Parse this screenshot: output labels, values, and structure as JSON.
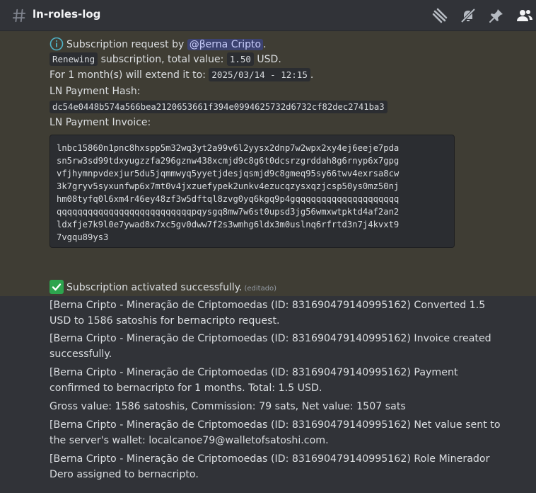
{
  "channel": {
    "name": "ln-roles-log"
  },
  "header_icons": [
    "threads-icon",
    "mute-bell-icon",
    "pin-icon",
    "members-icon"
  ],
  "embed": {
    "request_text": "Subscription request by",
    "mention": "@βerna Cripto",
    "period_end": ".",
    "renewing_code": "Renewing",
    "renewing_rest": "subscription, total value:",
    "value_code": "1.50",
    "currency": "USD.",
    "extend_text": "For 1 month(s) will extend it to:",
    "extend_date": "2025/03/14 - 12:15",
    "hash_label": "LN Payment Hash:",
    "hash_value": "dc54e0448b574a566bea2120653661f394e0994625732d6732cf82dec2741ba3",
    "invoice_label": "LN Payment Invoice:",
    "invoice_lines": [
      "lnbc15860n1pnc8hxspp5m32wq3yt2a99v6l2yysx2dnp7w2wpx2xy4ej6eeje7pda",
      "sn5rw3sd99tdxyugzzfa296gznw438xcmjd9c8g6t0dcsrzgrddah8g6rnyp6x7gpg",
      "vfjhymnpvdexjur5du5jqmmwyq5yyetjdesjqsmjd9c8gmeq95sy66twv4exrsa8cw",
      "3k7gryv5syxunfwp6x7mt0v4jxzuefypek2unkv4ezucqzysxqzjcsp50ys0mz50nj",
      "hm08tyfq0l6xm4r46ey48zf3w5dftql8zvg0yq6kgq9p4gqqqqqqqqqqqqqqqqqqqq",
      "qqqqqqqqqqqqqqqqqqqqqqqqqqpqysgq8mw7w6st0upsd3jg56wmxwtpktd4af2an2",
      "ldxfje7k9l0e7ywad8x7xc5gv0dww7f2s3wmhg6ldx3m0uslnq6rfrtd3n7j4kvxt9",
      "7vgqu89ys3"
    ],
    "success_text": "Subscription activated successfully.",
    "edited_label": "(editado)"
  },
  "messages": [
    "[Berna Cripto - Mineração de Criptomoedas (ID: 831690479140995162) Converted 1.5 USD to 1586 satoshis for bernacripto request.",
    "[Berna Cripto - Mineração de Criptomoedas (ID: 831690479140995162) Invoice created successfully.",
    "[Berna Cripto - Mineração de Criptomoedas (ID: 831690479140995162) Payment confirmed to bernacripto for 1 months. Total: 1.5 USD.",
    "Gross value: 1586 satoshis, Commission: 79 sats, Net value: 1507 sats",
    "[Berna Cripto - Mineração de Criptomoedas (ID: 831690479140995162) Net value sent to the server's wallet: localcanoe79@walletofsatoshi.com.",
    "[Berna Cripto - Mineração de Criptomoedas (ID: 831690479140995162) Role Minerador Dero assigned to bernacripto."
  ],
  "colors": {
    "background": "#313338",
    "highlight": "#3f3d34",
    "mention_bg": "#3c4270",
    "check_green": "#2da44e"
  }
}
